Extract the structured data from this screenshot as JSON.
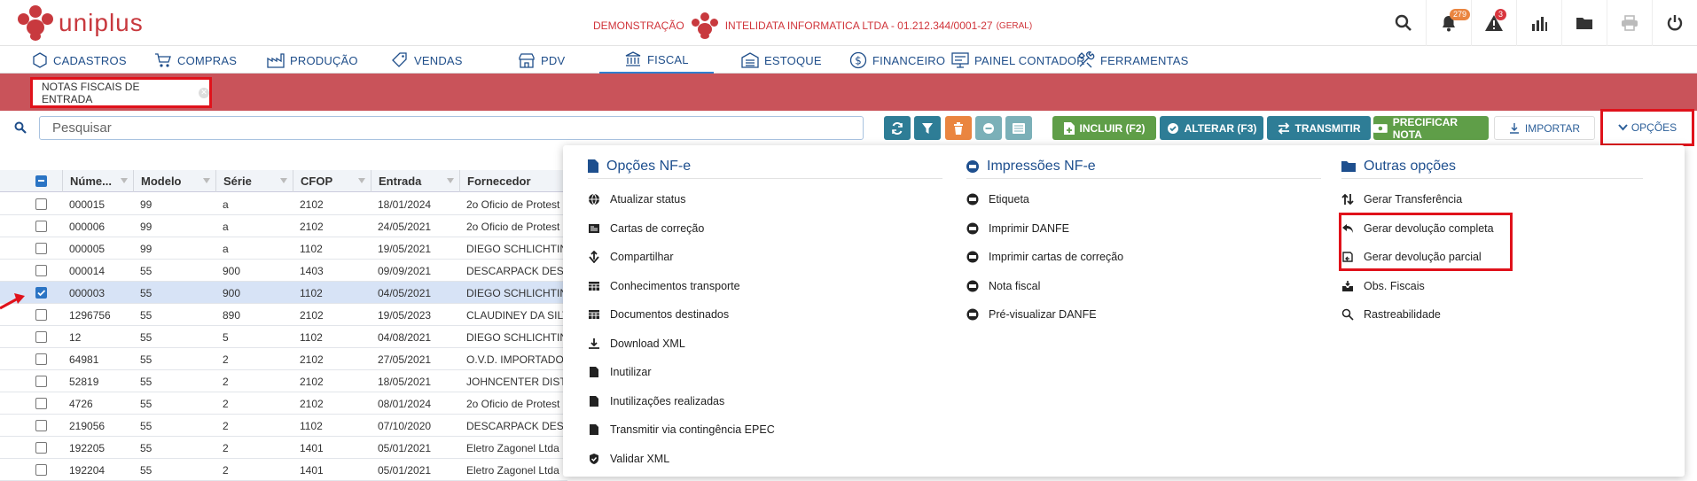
{
  "app": {
    "logo_text": "uniplus",
    "brand_color": "#c8393e"
  },
  "company": {
    "mode": "DEMONSTRAÇÃO",
    "name": "INTELIDATA INFORMATICA LTDA - 01.212.344/0001-27",
    "scope": "(GERAL)"
  },
  "top_icons": [
    {
      "name": "search-icon"
    },
    {
      "name": "bell-icon",
      "badge": "279"
    },
    {
      "name": "alert-icon",
      "badge": "3"
    },
    {
      "name": "chart-icon"
    },
    {
      "name": "folder-icon"
    },
    {
      "name": "printer-icon"
    },
    {
      "name": "power-icon"
    }
  ],
  "menu": [
    {
      "label": "CADASTROS",
      "icon": "cube-icon"
    },
    {
      "label": "COMPRAS",
      "icon": "cart-icon"
    },
    {
      "label": "PRODUÇÃO",
      "icon": "factory-icon"
    },
    {
      "label": "VENDAS",
      "icon": "tag-icon"
    },
    {
      "label": "PDV",
      "icon": "store-icon"
    },
    {
      "label": "FISCAL",
      "icon": "landmark-icon",
      "active": true
    },
    {
      "label": "ESTOQUE",
      "icon": "warehouse-icon"
    },
    {
      "label": "FINANCEIRO",
      "icon": "dollar-icon"
    },
    {
      "label": "PAINEL CONTADOR",
      "icon": "panel-icon"
    },
    {
      "label": "FERRAMENTAS",
      "icon": "tools-icon"
    }
  ],
  "tab": {
    "label": "NOTAS FISCAIS DE ENTRADA"
  },
  "search": {
    "placeholder": "Pesquisar"
  },
  "toolbar": {
    "incluir": "INCLUIR (F2)",
    "alterar": "ALTERAR (F3)",
    "transmitir": "TRANSMITIR",
    "precificar": "PRECIFICAR NOTA",
    "importar": "IMPORTAR",
    "opcoes": "OPÇÕES"
  },
  "grid": {
    "columns": [
      "Núme...",
      "Modelo",
      "Série",
      "CFOP",
      "Entrada",
      "Fornecedor"
    ],
    "rows": [
      {
        "numero": "000015",
        "modelo": "99",
        "serie": "a",
        "cfop": "2102",
        "entrada": "18/01/2024",
        "fornecedor": "2o Oficio de Protest"
      },
      {
        "numero": "000006",
        "modelo": "99",
        "serie": "a",
        "cfop": "2102",
        "entrada": "24/05/2021",
        "fornecedor": "2o Oficio de Protest"
      },
      {
        "numero": "000005",
        "modelo": "99",
        "serie": "a",
        "cfop": "1102",
        "entrada": "19/05/2021",
        "fornecedor": "DIEGO SCHLICHTIN"
      },
      {
        "numero": "000014",
        "modelo": "55",
        "serie": "900",
        "cfop": "1403",
        "entrada": "09/09/2021",
        "fornecedor": "DESCARPACK DESC"
      },
      {
        "numero": "000003",
        "modelo": "55",
        "serie": "900",
        "cfop": "1102",
        "entrada": "04/05/2021",
        "fornecedor": "DIEGO SCHLICHTIN",
        "selected": true
      },
      {
        "numero": "1296756",
        "modelo": "55",
        "serie": "890",
        "cfop": "2102",
        "entrada": "19/05/2023",
        "fornecedor": "CLAUDINEY DA SILV"
      },
      {
        "numero": "12",
        "modelo": "55",
        "serie": "5",
        "cfop": "1102",
        "entrada": "04/08/2021",
        "fornecedor": "DIEGO SCHLICHTIN"
      },
      {
        "numero": "64981",
        "modelo": "55",
        "serie": "2",
        "cfop": "2102",
        "entrada": "27/05/2021",
        "fornecedor": "O.V.D. IMPORTADO"
      },
      {
        "numero": "52819",
        "modelo": "55",
        "serie": "2",
        "cfop": "2102",
        "entrada": "18/05/2021",
        "fornecedor": "JOHNCENTER DISTR"
      },
      {
        "numero": "4726",
        "modelo": "55",
        "serie": "2",
        "cfop": "2102",
        "entrada": "08/01/2024",
        "fornecedor": "2o Oficio de Protest"
      },
      {
        "numero": "219056",
        "modelo": "55",
        "serie": "2",
        "cfop": "1102",
        "entrada": "07/10/2020",
        "fornecedor": "DESCARPACK DESC"
      },
      {
        "numero": "192205",
        "modelo": "55",
        "serie": "2",
        "cfop": "1401",
        "entrada": "05/01/2021",
        "fornecedor": "Eletro Zagonel Ltda"
      },
      {
        "numero": "192204",
        "modelo": "55",
        "serie": "2",
        "cfop": "1401",
        "entrada": "05/01/2021",
        "fornecedor": "Eletro Zagonel Ltda"
      }
    ]
  },
  "options": {
    "col1": {
      "title": "Opções NF-e",
      "items": [
        {
          "label": "Atualizar status",
          "icon": "globe-icon"
        },
        {
          "label": "Cartas de correção",
          "icon": "newspaper-icon"
        },
        {
          "label": "Compartilhar",
          "icon": "share-icon"
        },
        {
          "label": "Conhecimentos transporte",
          "icon": "table-icon"
        },
        {
          "label": "Documentos destinados",
          "icon": "table-icon"
        },
        {
          "label": "Download XML",
          "icon": "download-icon"
        },
        {
          "label": "Inutilizar",
          "icon": "file-icon"
        },
        {
          "label": "Inutilizações realizadas",
          "icon": "file-icon"
        },
        {
          "label": "Transmitir via contingência EPEC",
          "icon": "file-icon"
        },
        {
          "label": "Validar XML",
          "icon": "shield-icon"
        }
      ]
    },
    "col2": {
      "title": "Impressões NF-e",
      "items": [
        {
          "label": "Etiqueta",
          "icon": "print-icon"
        },
        {
          "label": "Imprimir DANFE",
          "icon": "print-icon"
        },
        {
          "label": "Imprimir cartas de correção",
          "icon": "print-icon"
        },
        {
          "label": "Nota fiscal",
          "icon": "print-icon"
        },
        {
          "label": "Pré-visualizar DANFE",
          "icon": "print-icon"
        }
      ]
    },
    "col3": {
      "title": "Outras opções",
      "items": [
        {
          "label": "Gerar Transferência",
          "icon": "transfer-icon"
        },
        {
          "label": "Gerar devolução completa",
          "icon": "reply-icon"
        },
        {
          "label": "Gerar devolução parcial",
          "icon": "return-icon"
        },
        {
          "label": "Obs. Fiscais",
          "icon": "inbox-icon"
        },
        {
          "label": "Rastreabilidade",
          "icon": "search-icon"
        }
      ]
    }
  }
}
